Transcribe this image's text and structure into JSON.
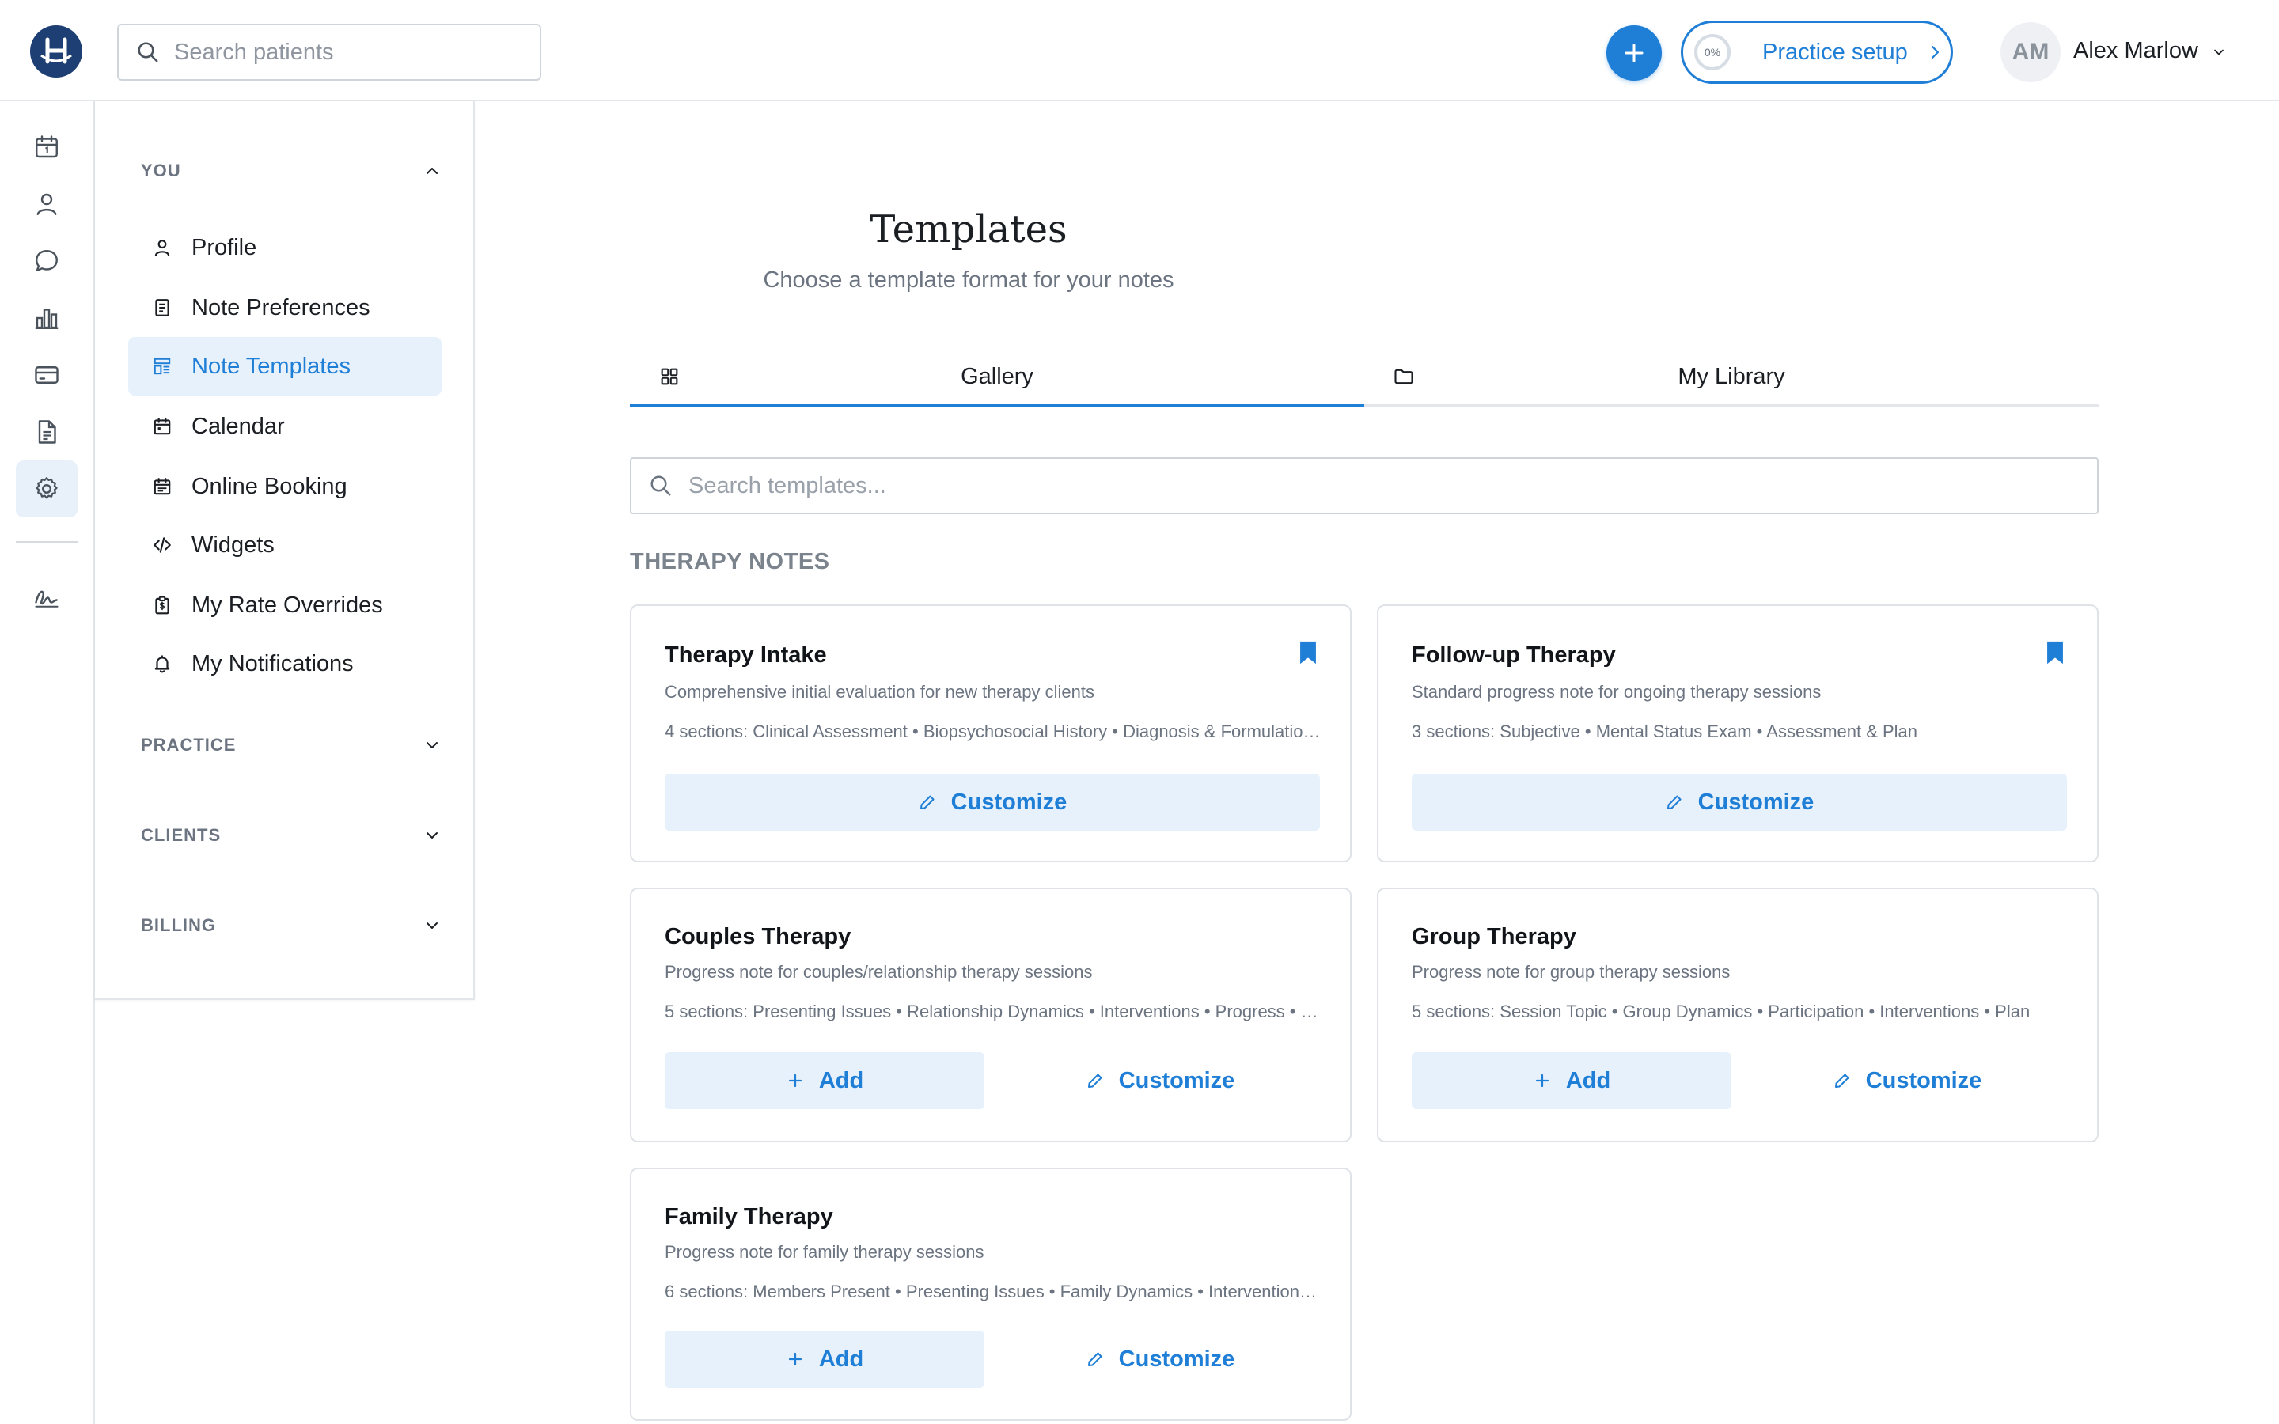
{
  "topbar": {
    "search_placeholder": "Search patients",
    "setup_progress": "0%",
    "setup_label": "Practice setup",
    "user_initials": "AM",
    "user_name": "Alex Marlow"
  },
  "rail": {
    "icons": [
      "calendar-icon",
      "person-icon",
      "chat-icon",
      "bar-chart-icon",
      "credit-card-icon",
      "document-icon",
      "gear-icon",
      "signature-icon"
    ],
    "active": "gear-icon"
  },
  "settings_nav": {
    "groups": [
      {
        "title": "YOU",
        "expanded": true,
        "items": [
          {
            "label": "Profile",
            "icon": "user-icon"
          },
          {
            "label": "Note Preferences",
            "icon": "note-icon"
          },
          {
            "label": "Note Templates",
            "icon": "template-icon",
            "active": true
          },
          {
            "label": "Calendar",
            "icon": "calendar-icon"
          },
          {
            "label": "Online Booking",
            "icon": "calendar-booking-icon"
          },
          {
            "label": "Widgets",
            "icon": "code-icon"
          },
          {
            "label": "My Rate Overrides",
            "icon": "clipboard-dollar-icon"
          },
          {
            "label": "My Notifications",
            "icon": "bell-icon"
          }
        ]
      },
      {
        "title": "PRACTICE",
        "expanded": false
      },
      {
        "title": "CLIENTS",
        "expanded": false
      },
      {
        "title": "BILLING",
        "expanded": false
      }
    ]
  },
  "main": {
    "title": "Templates",
    "subtitle": "Choose a template format for your notes",
    "tabs": [
      {
        "label": "Gallery",
        "icon": "grid-icon",
        "active": true
      },
      {
        "label": "My Library",
        "icon": "folder-icon",
        "active": false
      }
    ],
    "search_placeholder": "Search templates...",
    "section_title": "THERAPY NOTES",
    "add_label": "Add",
    "customize_label": "Customize",
    "cards": [
      {
        "title": "Therapy Intake",
        "description": "Comprehensive initial evaluation for new therapy clients",
        "sections": "4 sections: Clinical Assessment • Biopsychosocial History • Diagnosis & Formulation • Treatment Plan",
        "added": true
      },
      {
        "title": "Follow-up Therapy",
        "description": "Standard progress note for ongoing therapy sessions",
        "sections": "3 sections: Subjective • Mental Status Exam • Assessment & Plan",
        "added": true
      },
      {
        "title": "Couples Therapy",
        "description": "Progress note for couples/relationship therapy sessions",
        "sections": "5 sections: Presenting Issues • Relationship Dynamics • Interventions • Progress • Plan",
        "added": false
      },
      {
        "title": "Group Therapy",
        "description": "Progress note for group therapy sessions",
        "sections": "5 sections: Session Topic • Group Dynamics • Participation • Interventions • Plan",
        "added": false
      },
      {
        "title": "Family Therapy",
        "description": "Progress note for family therapy sessions",
        "sections": "6 sections: Members Present • Presenting Issues • Family Dynamics • Interventions • Progress • Plan",
        "added": false
      }
    ]
  },
  "colors": {
    "accent": "#1f7ed6",
    "accent_light": "#e7f1fc",
    "logo_bg": "#1e3f73"
  }
}
